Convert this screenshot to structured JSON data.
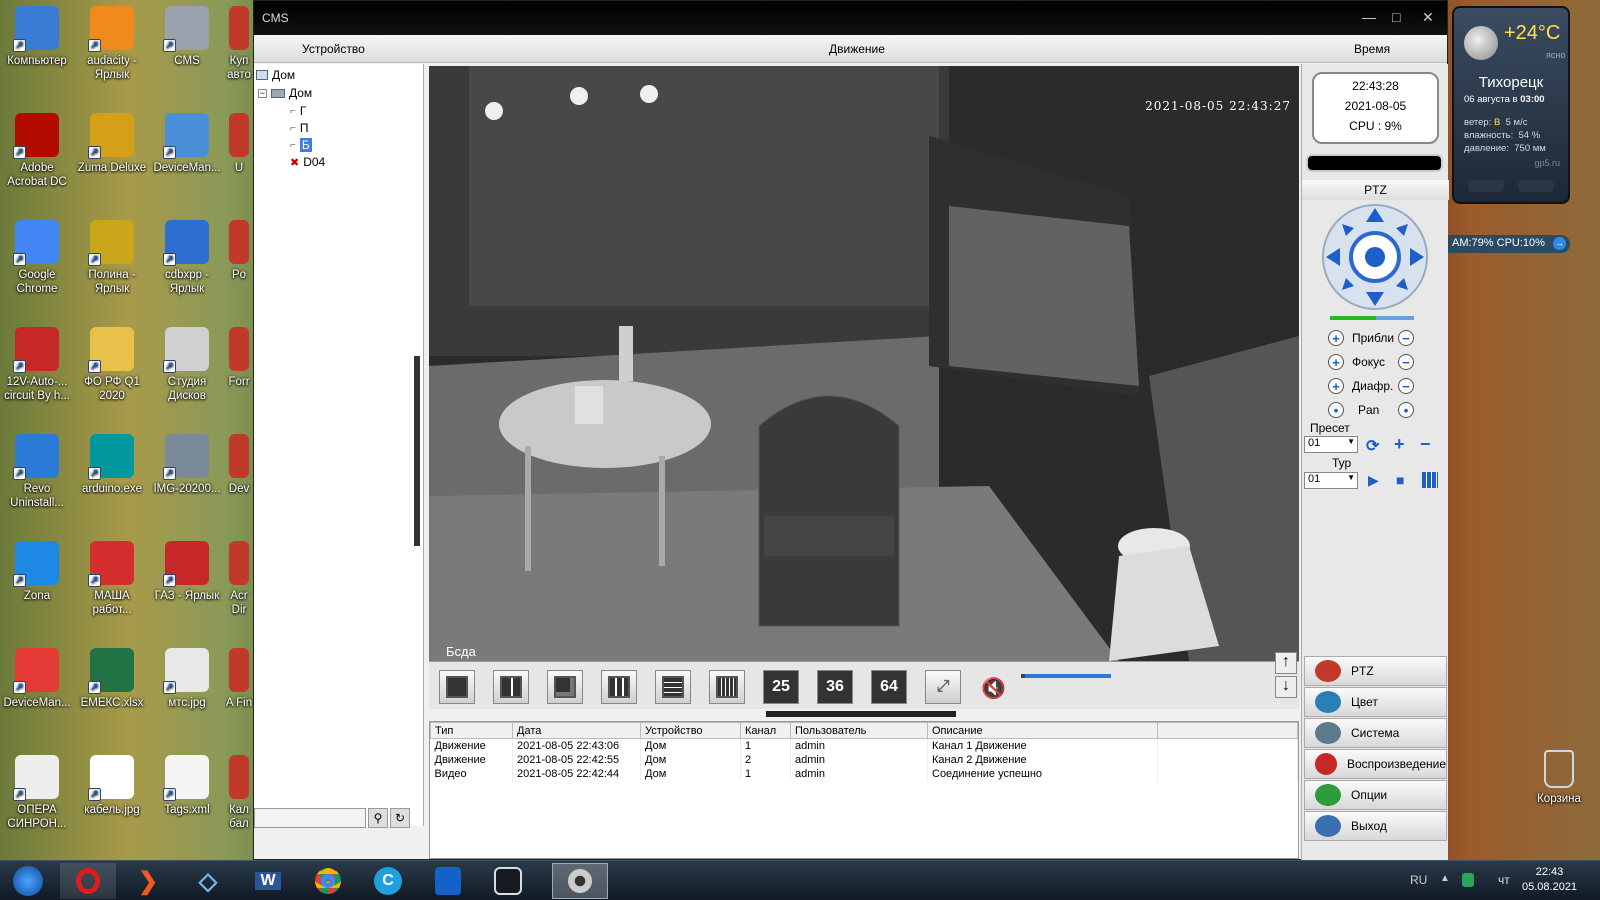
{
  "desktop": {
    "icons": [
      {
        "label": "Компьютер",
        "color": "#3a7bd5"
      },
      {
        "label": "audacity - Ярлык",
        "color": "#f08a1c"
      },
      {
        "label": "CMS",
        "color": "#9aa3ad"
      },
      {
        "label": "Adobe Acrobat DC",
        "color": "#b30b00"
      },
      {
        "label": "Zuma Deluxe",
        "color": "#d4a017"
      },
      {
        "label": "DeviceMan...",
        "color": "#4a8fd8"
      },
      {
        "label": "Google Chrome",
        "color": "#4285f4"
      },
      {
        "label": "Полина - Ярлык",
        "color": "#c9a61a"
      },
      {
        "label": "cdbxpp - Ярлык",
        "color": "#2d6fd0"
      },
      {
        "label": "12V-Auto-... circuit By h...",
        "color": "#c62828"
      },
      {
        "label": "ФО РФ Q1 2020",
        "color": "#e8c04a"
      },
      {
        "label": "Студия Дисков",
        "color": "#d0d0d0"
      },
      {
        "label": "Revo Uninstall...",
        "color": "#2a7bd8"
      },
      {
        "label": "arduino.exe",
        "color": "#00979d"
      },
      {
        "label": "IMG-20200...",
        "color": "#7a8a9a"
      },
      {
        "label": "Zona",
        "color": "#1e88e5"
      },
      {
        "label": "МАША работ...",
        "color": "#d32f2f"
      },
      {
        "label": "ГАЗ - Ярлык",
        "color": "#c62828"
      },
      {
        "label": "DeviceMan...",
        "color": "#e53935"
      },
      {
        "label": "ЕМЕКС.xlsx",
        "color": "#217346"
      },
      {
        "label": "мтс.jpg",
        "color": "#e8e8e8"
      },
      {
        "label": "ОПЕРА СИНРОН...",
        "color": "#eeeeee"
      },
      {
        "label": "кабель.jpg",
        "color": "#ffffff"
      },
      {
        "label": "Tags.xml",
        "color": "#f5f5f5"
      }
    ],
    "cut_icons": [
      "Куп авто",
      "U",
      "Po",
      "Forr",
      "Dev",
      "Acr Dir",
      "A Fin",
      "Кал бал"
    ],
    "recycle_bin": "Корзина"
  },
  "window": {
    "title": "CMS",
    "minimize": "—",
    "maximize": "□",
    "close": "✕",
    "menu": {
      "device": "Устройство",
      "motion": "Движение",
      "time": "Время"
    },
    "tree": {
      "root": "Дом",
      "group": "Дом",
      "channels": [
        "Г",
        "П",
        "Б",
        "D04"
      ]
    },
    "video": {
      "timestamp": "2021-08-05 22:43:27",
      "channel_label": "Бсда"
    },
    "layout_buttons": [
      "",
      "",
      "",
      "",
      "",
      "",
      "25",
      "36",
      "64"
    ],
    "events": {
      "headers": [
        "Тип",
        "Дата",
        "Устройство",
        "Канал",
        "Пользователь",
        "Описание"
      ],
      "rows": [
        [
          "Движение",
          "2021-08-05 22:43:06",
          "Дом",
          "1",
          "admin",
          "Канал 1 Движение"
        ],
        [
          "Движение",
          "2021-08-05 22:42:55",
          "Дом",
          "2",
          "admin",
          "Канал 2 Движение"
        ],
        [
          "Видео",
          "2021-08-05 22:42:44",
          "Дом",
          "1",
          "admin",
          "Соединение успешно"
        ]
      ]
    },
    "clock": {
      "time": "22:43:28",
      "date": "2021-08-05",
      "cpu": "CPU : 9%"
    },
    "ptz": {
      "title": "PTZ",
      "zoom": "Прибли",
      "focus": "Фокус",
      "iris": "Диафр.",
      "pan": "Pan",
      "preset_label": "Пресет",
      "preset_value": "01",
      "tour_label": "Тур",
      "tour_value": "01"
    },
    "nav": [
      "PTZ",
      "Цвет",
      "Система",
      "Воспроизведение",
      "Опции",
      "Выход"
    ]
  },
  "weather": {
    "temp": "+24°C",
    "cond": "ясно",
    "city": "Тихорецк",
    "date": "06 августа в",
    "time": "03:00",
    "wind_label": "ветер:",
    "wind_dir": "В",
    "wind_val": "5 м/с",
    "hum_label": "влажность:",
    "hum_val": "54 %",
    "press_label": "давление:",
    "press_val": "750 мм",
    "site": "gp5.ru"
  },
  "sysmon": "AM:79%  CPU:10%",
  "taskbar": {
    "lang": "RU",
    "day": "чт",
    "time": "22:43",
    "date": "05.08.2021"
  }
}
